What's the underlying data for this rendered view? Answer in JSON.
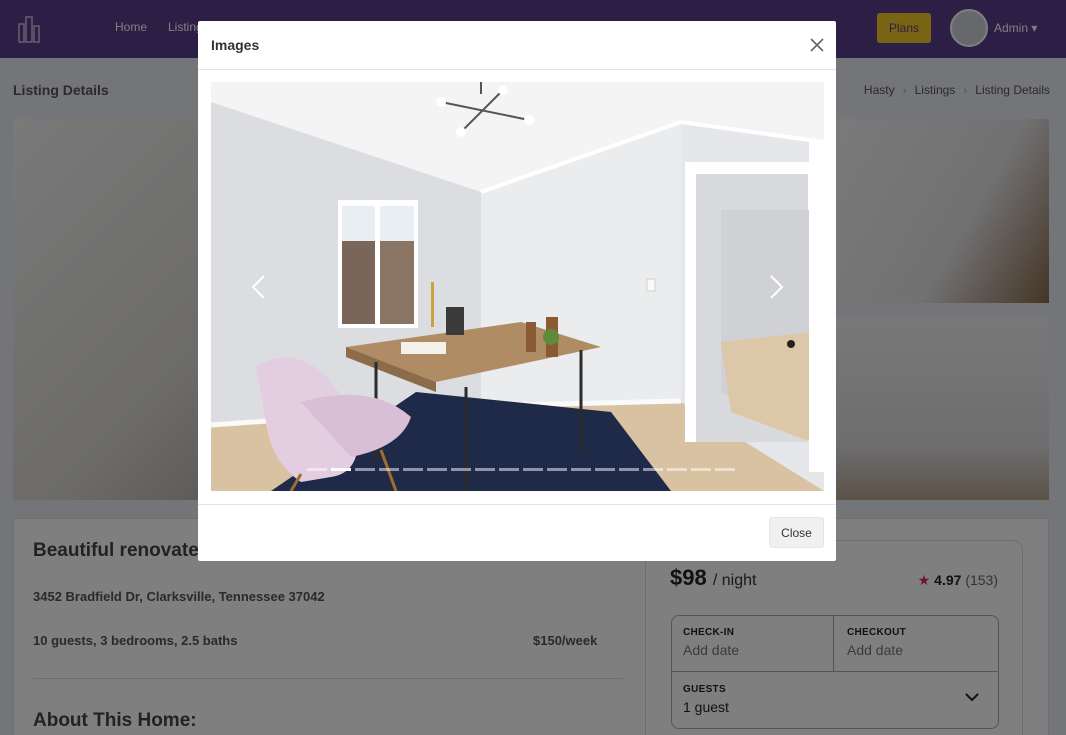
{
  "navbar": {
    "links": [
      "Home",
      "Listings"
    ],
    "plans_label": "Plans",
    "admin_label": "Admin"
  },
  "page": {
    "title": "Listing Details",
    "breadcrumb": [
      "Hasty",
      "Listings",
      "Listing Details"
    ]
  },
  "listing": {
    "title": "Beautiful renovated",
    "address": "3452 Bradfield Dr, Clarksville, Tennessee 37042",
    "specs": "10 guests, 3 bedrooms, 2.5 baths",
    "weekly_price": "$150/week",
    "about_heading": "About This Home:"
  },
  "booking": {
    "price": "$98",
    "per_night": "/ night",
    "rating": "4.97",
    "reviews": "(153)",
    "checkin_label": "CHECK-IN",
    "checkin_value": "Add date",
    "checkout_label": "CHECKOUT",
    "checkout_value": "Add date",
    "guests_label": "GUESTS",
    "guests_value": "1 guest"
  },
  "modal": {
    "title": "Images",
    "close_button": "Close",
    "carousel": {
      "slide_count": 18,
      "active_index": 1
    }
  },
  "colors": {
    "navbar": "#5b3d8a",
    "plans_button": "#f3c928",
    "star": "#e0245e"
  }
}
